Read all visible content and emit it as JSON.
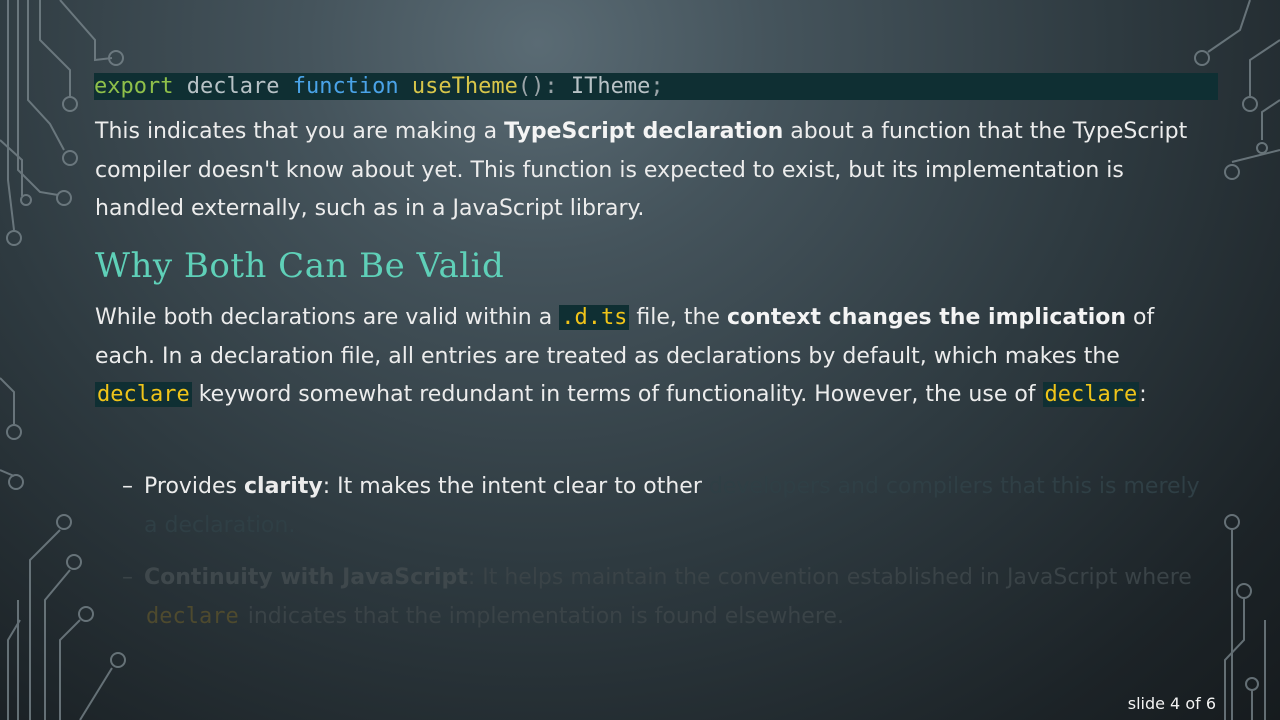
{
  "code_line": {
    "t1": "export",
    "t2": " declare ",
    "t3": "function",
    "t4": " ",
    "t5": "useTheme",
    "t6": "(): ",
    "t7": "ITheme",
    "t8": ";"
  },
  "para1": {
    "a": "This indicates that you are making a ",
    "b": "TypeScript declaration",
    "c": " about a function that the TypeScript compiler doesn't know about yet. This function is expected to exist, but its implementation is handled externally, such as in a JavaScript library."
  },
  "heading": "Why Both Can Be Valid",
  "para2": {
    "a": "While both declarations are valid within a ",
    "code1": ".d.ts",
    "b": " file, the ",
    "bold1": "context changes the implication",
    "c": " of each. In a declaration file, all entries are treated as declarations by default, which makes the ",
    "code2": "declare",
    "d": " keyword somewhat redundant in terms of functionality. However, the use of ",
    "code3": "declare",
    "e": ":"
  },
  "bullet1": {
    "dash": "–",
    "a": "Provides ",
    "bold": "clarity",
    "b": ": It makes the intent clear to other ",
    "faded": "developers and compilers that this is merely a declaration."
  },
  "bullet2": {
    "dash": "–",
    "bold": "Continuity with JavaScript",
    "a": ": It helps maintain the convention established in JavaScript where ",
    "code": "declare",
    "b": " indicates that the implementation is found elsewhere."
  },
  "slide_number": "slide 4 of 6",
  "colors": {
    "heading": "#5fd0b8",
    "inline_code": "#f0c419",
    "code_bg": "#0f2f33"
  }
}
